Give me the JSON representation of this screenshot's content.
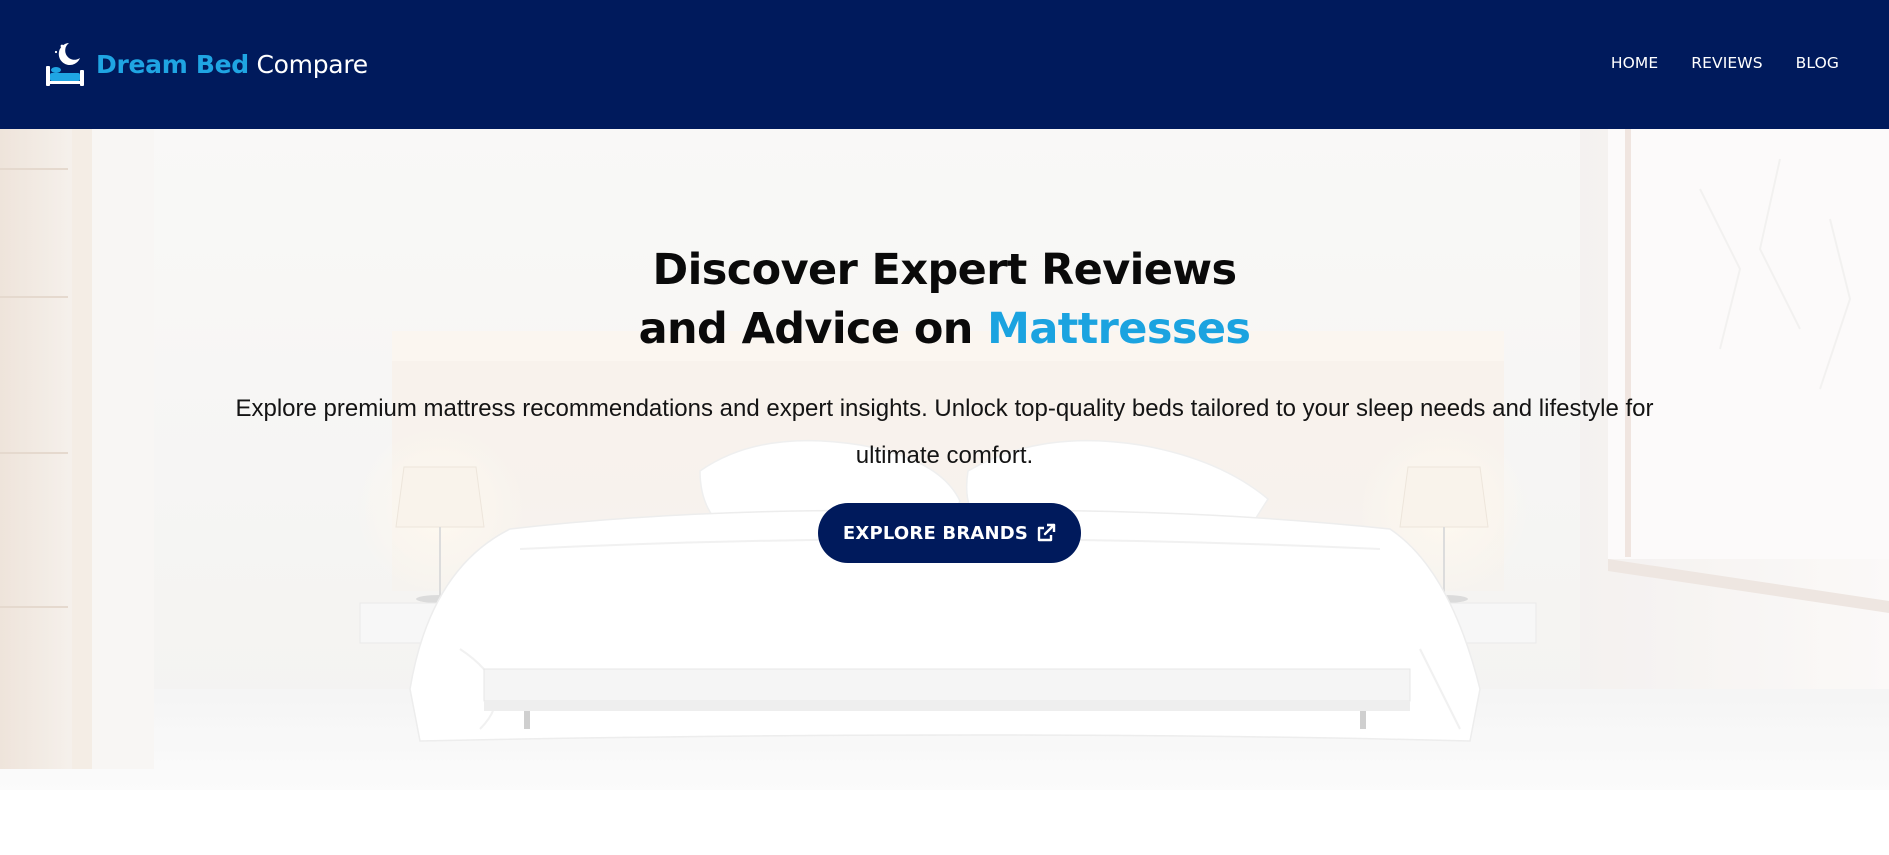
{
  "header": {
    "logo": {
      "brand_text": "Dream Bed",
      "rest_text": "Compare",
      "icon": "bed-moon-logo-icon"
    },
    "nav": [
      {
        "label": "HOME"
      },
      {
        "label": "REVIEWS"
      },
      {
        "label": "BLOG"
      }
    ]
  },
  "hero": {
    "title_line1": "Discover Expert Reviews",
    "title_line2_plain": "and Advice on ",
    "title_line2_accent": "Mattresses",
    "lede": "Explore premium mattress recommendations and expert insights. Unlock top-quality beds tailored to your sleep needs and lifestyle for ultimate comfort.",
    "cta_label": "EXPLORE BRANDS",
    "cta_icon": "external-link-icon",
    "background": "white-bedroom-photo"
  },
  "colors": {
    "header_bg": "#001a5c",
    "accent": "#1ba3e0",
    "cta_bg": "#001a5c"
  }
}
